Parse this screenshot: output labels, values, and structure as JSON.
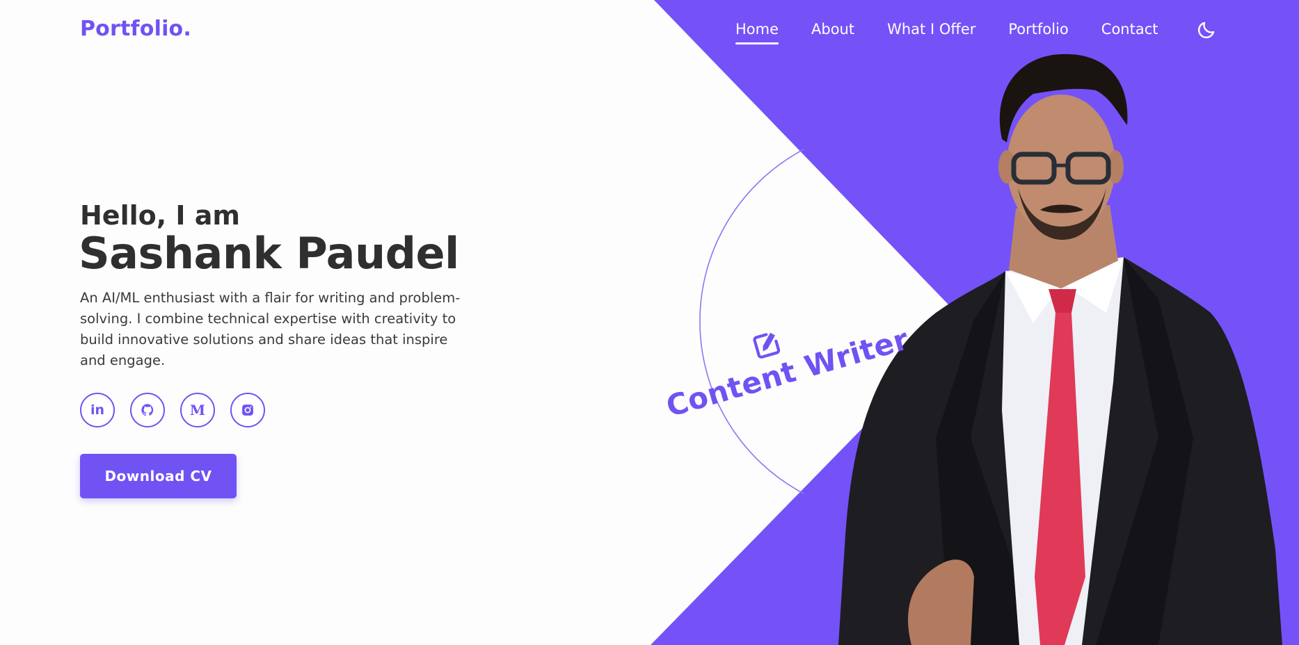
{
  "brand": {
    "logo": "Portfolio.",
    "accent": "#7152f3"
  },
  "nav": {
    "items": [
      {
        "label": "Home",
        "active": true
      },
      {
        "label": "About",
        "active": false
      },
      {
        "label": "What I Offer",
        "active": false
      },
      {
        "label": "Portfolio",
        "active": false
      },
      {
        "label": "Contact",
        "active": false
      }
    ],
    "theme_toggle_icon": "moon-icon"
  },
  "hero": {
    "greeting": "Hello, I am",
    "name": "Sashank Paudel",
    "bio": "An AI/ML enthusiast with a flair for writing and problem-solving. I combine technical expertise with creativity to build innovative solutions and share ideas that inspire and engage.",
    "socials": [
      {
        "name": "linkedin",
        "icon": "linkedin-icon",
        "glyph": "in"
      },
      {
        "name": "github",
        "icon": "github-icon",
        "glyph": ""
      },
      {
        "name": "medium",
        "icon": "medium-icon",
        "glyph": "M"
      },
      {
        "name": "instagram",
        "icon": "instagram-icon",
        "glyph": ""
      }
    ],
    "cta_label": "Download CV",
    "role_badge": {
      "label": "Content Writer",
      "icon": "edit-icon"
    }
  }
}
